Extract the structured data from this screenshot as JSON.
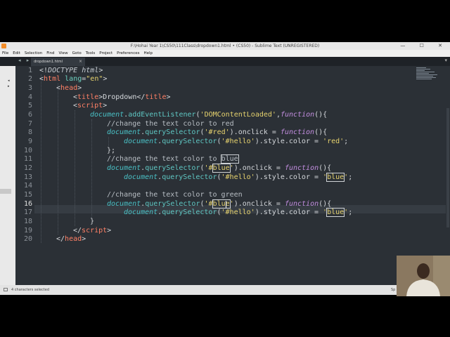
{
  "window": {
    "title": "F:\\Hohai Year 1\\CS50\\111Class\\dropdown1.html • (CS50) - Sublime Text (UNREGISTERED)",
    "controls": "—  ☐  ✕"
  },
  "menu": [
    "File",
    "Edit",
    "Selection",
    "Find",
    "View",
    "Goto",
    "Tools",
    "Project",
    "Preferences",
    "Help"
  ],
  "tabs": [
    {
      "label": "dropdown1.html",
      "close": "×"
    }
  ],
  "nav_arrows": "◂ ▸",
  "tab_dropdown": "▾",
  "gutter": {
    "lines": [
      "1",
      "2",
      "3",
      "4",
      "5",
      "6",
      "7",
      "8",
      "9",
      "10",
      "11",
      "12",
      "13",
      "14",
      "15",
      "16",
      "17",
      "18",
      "19",
      "20"
    ],
    "current_line": "16"
  },
  "code": {
    "l1": {
      "a": "<!",
      "b": "DOCTYPE",
      "c": " ",
      "d": "html",
      "e": ">"
    },
    "l2": {
      "a": "<",
      "b": "html",
      "c": " ",
      "d": "lang",
      "e": "=",
      "f": "\"en\"",
      "g": ">"
    },
    "l3": {
      "a": "<",
      "b": "head",
      "c": ">"
    },
    "l4": {
      "a": "<",
      "b": "title",
      "c": ">",
      "d": "Dropdown",
      "e": "</",
      "f": "title",
      "g": ">"
    },
    "l5": {
      "a": "<",
      "b": "script",
      "c": ">"
    },
    "l6": {
      "a": "document",
      "b": ".",
      "c": "addEventListener",
      "d": "(",
      "e": "'DOMContentLoaded'",
      "f": ",",
      "g": "function",
      "h": "(){"
    },
    "l7": {
      "a": "//change the text color to red"
    },
    "l8": {
      "a": "document",
      "b": ".",
      "c": "querySelector",
      "d": "(",
      "e": "'#red'",
      "f": ").",
      "g": "onclick",
      "h": " = ",
      "i": "function",
      "j": "(){"
    },
    "l9": {
      "a": "document",
      "b": ".",
      "c": "querySelector",
      "d": "(",
      "e": "'#hello'",
      "f": ").",
      "g": "style",
      "h": ".",
      "i": "color",
      "j": " = ",
      "k": "'red'",
      "l": ";"
    },
    "l10": {
      "a": "};"
    },
    "l11": {
      "a": "//change the text color to ",
      "b": "blue"
    },
    "l12": {
      "a": "document",
      "b": ".",
      "c": "querySelector",
      "d": "(",
      "e": "'#",
      "f": "blue",
      "g": "'",
      "h": ").",
      "i": "onclick",
      "j": " = ",
      "k": "function",
      "l": "(){"
    },
    "l13": {
      "a": "document",
      "b": ".",
      "c": "querySelector",
      "d": "(",
      "e": "'#hello'",
      "f": ").",
      "g": "style",
      "h": ".",
      "i": "color",
      "j": " = ",
      "k": "'",
      "l": "blue",
      "m": "'",
      "n": ";"
    },
    "l15": {
      "a": "//change the text color to green"
    },
    "l16": {
      "a": "document",
      "b": ".",
      "c": "querySelector",
      "d": "(",
      "e": "'#",
      "f": "blue",
      "g": "'",
      "h": ").",
      "i": "onclick",
      "j": " = ",
      "k": "function",
      "l": "(){"
    },
    "l17": {
      "a": "document",
      "b": ".",
      "c": "querySelector",
      "d": "(",
      "e": "'#hello'",
      "f": ").",
      "g": "style",
      "h": ".",
      "i": "color",
      "j": " = ",
      "k": "'",
      "l": "blue",
      "m": "'",
      "n": ";"
    },
    "l18": {
      "a": "}"
    },
    "l19": {
      "a": "</",
      "b": "script",
      "c": ">"
    },
    "l20": {
      "a": "</",
      "b": "head",
      "c": ">"
    }
  },
  "status": {
    "selection": "4 characters selected",
    "spaces": "Sp"
  },
  "colors": {
    "background": "#2b3036",
    "tag": "#ff8066",
    "string": "#e6d26e",
    "method": "#5fc7c3",
    "keyword": "#c38ee0"
  }
}
